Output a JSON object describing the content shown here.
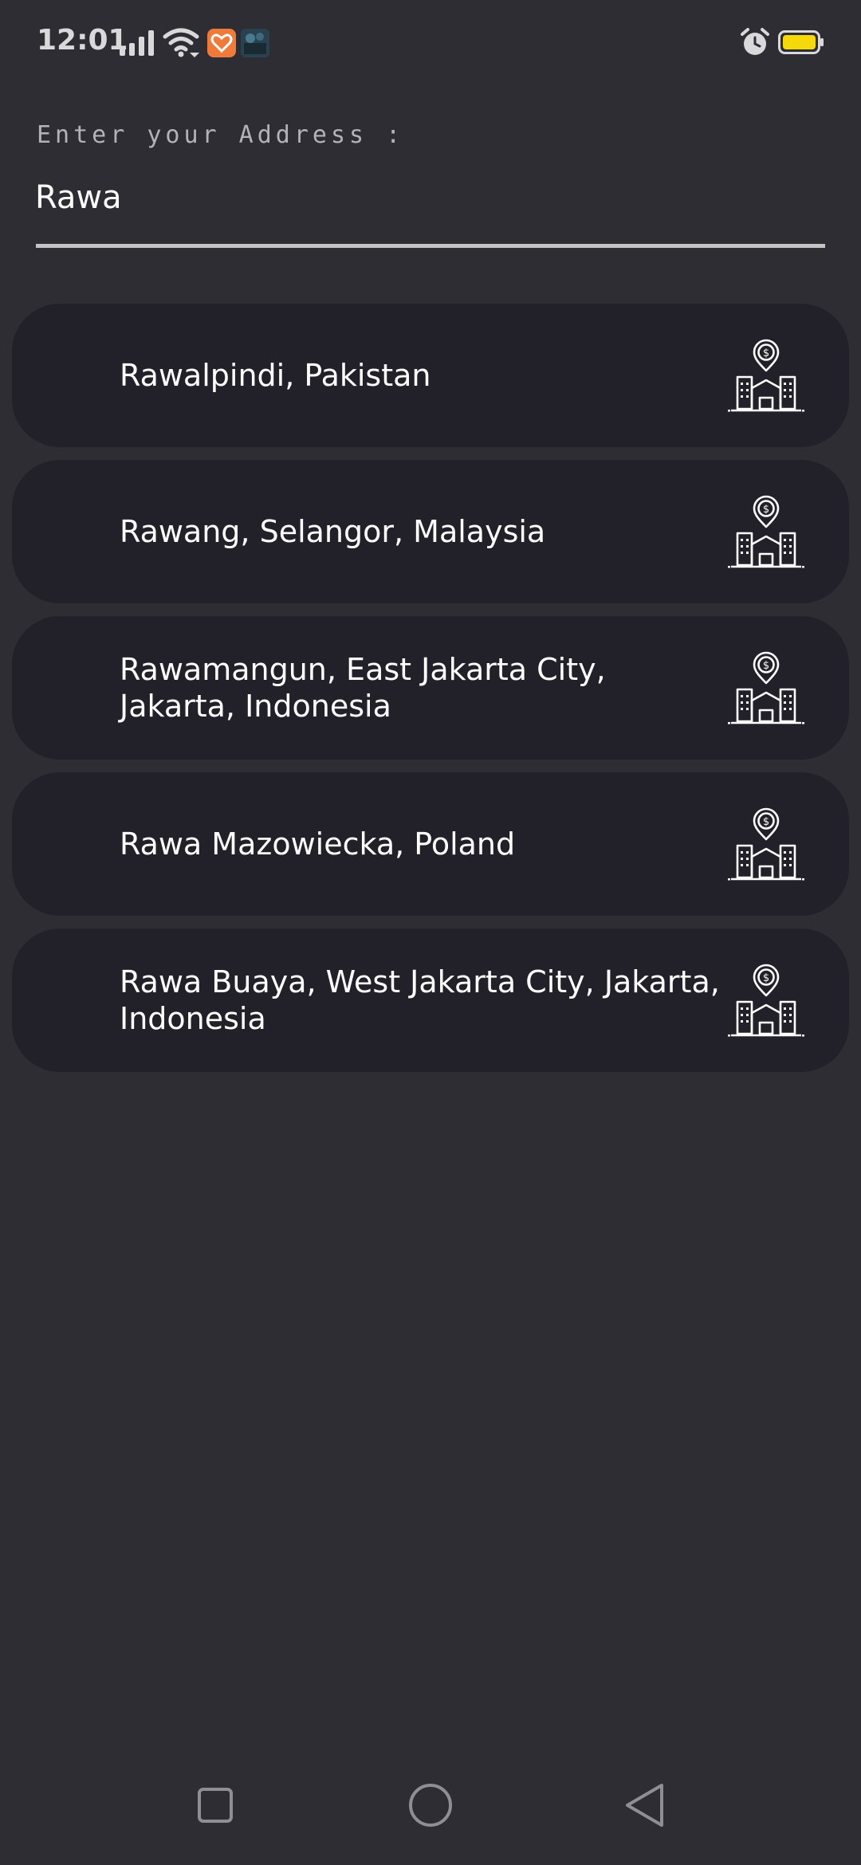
{
  "status_bar": {
    "time": "12:01"
  },
  "address": {
    "label": "Enter your Address :",
    "value": "Rawa"
  },
  "results": [
    {
      "label": "Rawalpindi, Pakistan",
      "icon": "location-building-icon"
    },
    {
      "label": "Rawang, Selangor, Malaysia",
      "icon": "location-building-icon"
    },
    {
      "label": "Rawamangun, East Jakarta City, Jakarta, Indonesia",
      "icon": "location-building-icon"
    },
    {
      "label": "Rawa Mazowiecka, Poland",
      "icon": "location-building-icon"
    },
    {
      "label": "Rawa Buaya, West Jakarta City, Jakarta, Indonesia",
      "icon": "location-building-icon"
    }
  ],
  "colors": {
    "background": "#2e2d33",
    "card": "#22212a",
    "battery": "#f5d90a",
    "app_badge": "#f07a3a"
  }
}
